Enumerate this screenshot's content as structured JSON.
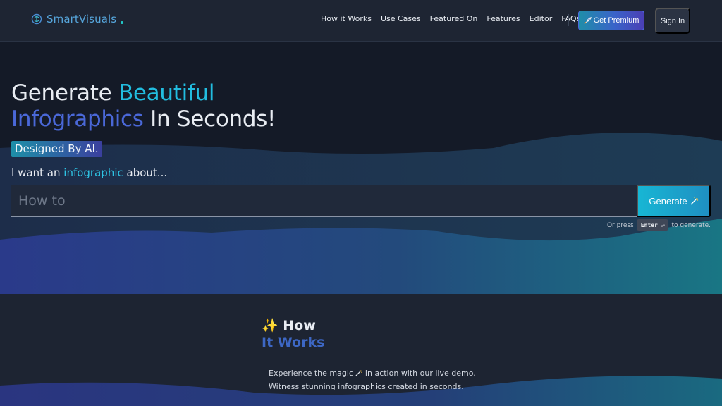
{
  "brand": {
    "name": "SmartVisuals"
  },
  "nav": {
    "links": [
      "How it Works",
      "Use Cases",
      "Featured On",
      "Features",
      "Editor",
      "FAQs"
    ],
    "premium_label": "Get Premium",
    "premium_icon": "rocket",
    "signin_label": "Sign In"
  },
  "hero": {
    "title_part1": "Generate ",
    "title_highlight1": "Beautiful",
    "title_highlight2": "Infographics",
    "title_part2": " In Seconds!",
    "badge": "Designed By AI.",
    "prompt_prefix": "I want an ",
    "prompt_highlight": "infographic",
    "prompt_suffix": " about...",
    "input_placeholder": "How to",
    "input_value": "",
    "generate_label": "Generate",
    "generate_icon": "magic-wand",
    "hint_prefix": "Or press",
    "hint_key": "Enter ↵",
    "hint_suffix": "to generate."
  },
  "how_it_works": {
    "title_line1": "✨ How",
    "title_line2": "It Works",
    "desc_line1_prefix": "Experience the magic ",
    "desc_line1_suffix": " in action with our live demo.",
    "desc_line2": "Witness stunning infographics created in seconds."
  },
  "colors": {
    "accent_teal": "#22bde0",
    "accent_indigo": "#4a68d8",
    "nav_bg": "#1e2533",
    "hero_bg": "#141a27"
  }
}
